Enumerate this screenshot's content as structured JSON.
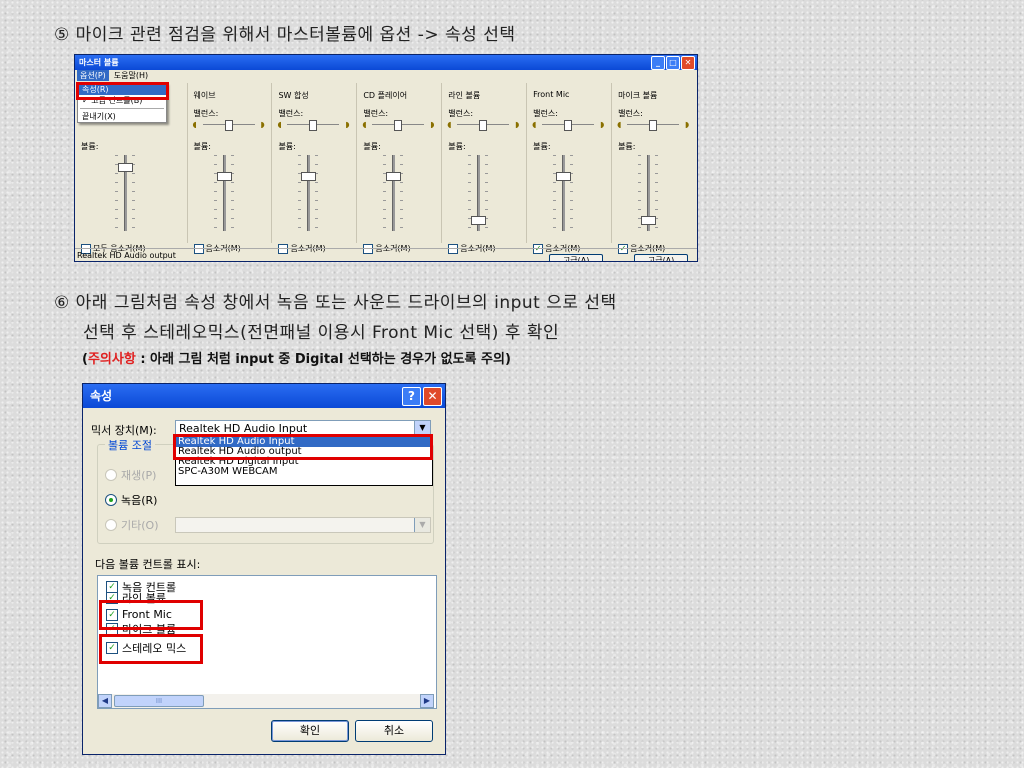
{
  "steps": {
    "step5": "⑤ 마이크 관련 점검을 위해서 마스터볼륨에 옵션 -> 속성 선택",
    "step6_line1": "⑥ 아래 그림처럼 속성 창에서 녹음 또는 사운드 드라이브의 input 으로 선택",
    "step6_line2": "선택 후 스테레오믹스(전면패널 이용시 Front Mic 선택) 후 확인",
    "note_open": "(",
    "note_warn": "주의사항",
    "note_rest": " : 아래 그림 처럼 input 중 Digital 선택하는 경우가 없도록 주의)"
  },
  "mixer": {
    "title": "마스터 볼륨",
    "menu": [
      "옵션(P)",
      "도움말(H)"
    ],
    "dropdown": {
      "item1": "속성(R)",
      "item2": "✓ 고급 컨트롤(B)",
      "item3": "끝내기(X)"
    },
    "first_channel": {
      "balance": "밸런스:",
      "volume": "볼륨:",
      "mute_all": "모두 음소거(M)"
    },
    "channels": [
      {
        "name": "웨이브",
        "balance": "밸런스:",
        "volume": "볼륨:",
        "mute": "음소거(M)",
        "checked": false,
        "level": 0.75
      },
      {
        "name": "SW 합성",
        "balance": "밸런스:",
        "volume": "볼륨:",
        "mute": "음소거(M)",
        "checked": false,
        "level": 0.75
      },
      {
        "name": "CD 플레이어",
        "balance": "밸런스:",
        "volume": "볼륨:",
        "mute": "음소거(M)",
        "checked": false,
        "level": 0.75
      },
      {
        "name": "라인 볼륨",
        "balance": "밸런스:",
        "volume": "볼륨:",
        "mute": "음소거(M)",
        "checked": false,
        "level": 0.1
      },
      {
        "name": "Front Mic",
        "balance": "밸런스:",
        "volume": "볼륨:",
        "mute": "음소거(M)",
        "checked": true,
        "level": 0.75,
        "advanced": "고급(A)"
      },
      {
        "name": "마이크 볼륨",
        "balance": "밸런스:",
        "volume": "볼륨:",
        "mute": "음소거(M)",
        "checked": true,
        "level": 0.1,
        "advanced": "고급(A)"
      }
    ],
    "status": "Realtek HD Audio output"
  },
  "props": {
    "title": "속성",
    "help_glyph": "?",
    "close_glyph": "✕",
    "mixer_label": "믹서 장치(M):",
    "mixer_value": "Realtek HD Audio Input",
    "options": [
      "Realtek HD Audio Input",
      "Realtek HD Audio output",
      "Realtek HD Digital Input",
      "SPC-A30M WEBCAM"
    ],
    "group_label": "볼륨 조절",
    "radio_play": "재생(P)",
    "radio_record": "녹음(R)",
    "radio_other": "기타(O)",
    "show_label": "다음 볼륨 컨트롤 표시:",
    "controls": [
      "녹음 컨트롤",
      "라인 볼륨",
      "Front Mic",
      "마이크 볼륨",
      "스테레오 믹스"
    ],
    "scroll_thumb": "III",
    "ok": "확인",
    "cancel": "취소"
  },
  "colors": {
    "warning": "#e02020",
    "highlight": "#e00000",
    "titlebar": "#0b49d6"
  }
}
